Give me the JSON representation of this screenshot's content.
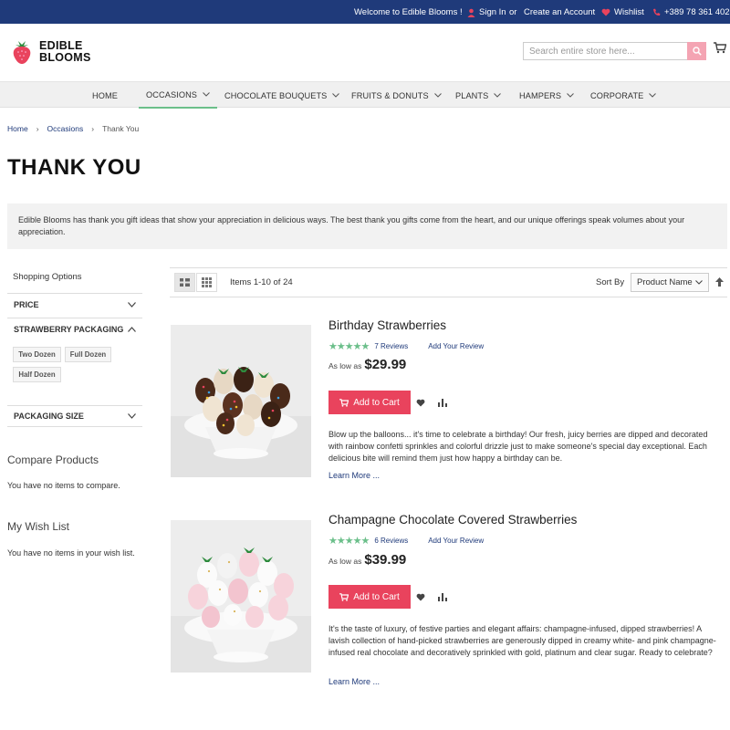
{
  "topbar": {
    "welcome": "Welcome to Edible Blooms !",
    "sign_in": "Sign In",
    "or": "or",
    "create_account": "Create an Account",
    "wishlist": "Wishlist",
    "phone": "+389 78 361 402"
  },
  "logo": {
    "line1": "EDIBLE",
    "line2": "BLOOMS"
  },
  "search": {
    "placeholder": "Search entire store here..."
  },
  "nav": {
    "home": "HOME",
    "occasions": "OCCASIONS",
    "chocolate_bouquets": "CHOCOLATE BOUQUETS",
    "fruits_donuts": "FRUITS & DONUTS",
    "plants": "PLANTS",
    "hampers": "HAMPERS",
    "corporate": "CORPORATE"
  },
  "breadcrumb": {
    "home": "Home",
    "occasions": "Occasions",
    "current": "Thank You",
    "separator": "›"
  },
  "page": {
    "title": "THANK YOU",
    "description": "Edible Blooms has thank you gift ideas that show your appreciation in delicious ways. The best thank you gifts come from the heart, and our unique offerings speak volumes about your appreciation."
  },
  "sidebar": {
    "title": "Shopping Options",
    "filters": {
      "price": "PRICE",
      "packaging": "STRAWBERRY PACKAGING",
      "packaging_size": "PACKAGING SIZE"
    },
    "swatches": {
      "two": "Two Dozen",
      "full": "Full Dozen",
      "half": "Half Dozen"
    },
    "compare_title": "Compare Products",
    "compare_note": "You have no items to compare.",
    "wishlist_title": "My Wish List",
    "wishlist_note": "You have no items in your wish list."
  },
  "toolbar": {
    "amount": "Items 1-10 of 24",
    "sort_label": "Sort By",
    "sort_value": "Product Name"
  },
  "products": [
    {
      "name": "Birthday Strawberries",
      "rating": 5,
      "reviews": "7  Reviews",
      "add_review": "Add Your Review",
      "price_label": "As low as",
      "price": "$29.99",
      "add_to_cart": "Add to Cart",
      "description": "Blow up the balloons... it's time to celebrate a birthday! Our fresh, juicy berries are dipped and decorated with rainbow confetti sprinkles and colorful drizzle just to make someone's special day exceptional. Each delicious bite will remind them just how happy a birthday can be.",
      "more": "Learn More ..."
    },
    {
      "name": "Champagne Chocolate Covered Strawberries",
      "rating": 5,
      "reviews": "6  Reviews",
      "add_review": "Add Your Review",
      "price_label": "As low as",
      "price": "$39.99",
      "add_to_cart": "Add to Cart",
      "description": "It's the taste of luxury, of festive parties and elegant affairs: champagne-infused, dipped strawberries! A lavish collection of hand-picked strawberries are generously dipped in creamy white- and pink champagne-infused real chocolate and decoratively sprinkled with gold, platinum and clear sugar. Ready to celebrate?",
      "more": "Learn More ..."
    }
  ],
  "colors": {
    "topbar": "#1f3a7a",
    "accent": "#e9435d",
    "stars": "#6bbf8a",
    "link": "#1f3a7a"
  }
}
